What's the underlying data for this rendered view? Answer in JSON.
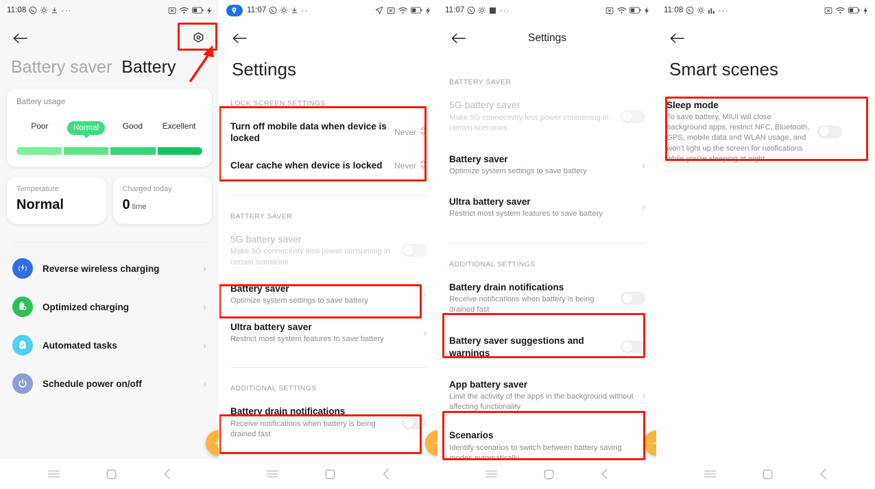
{
  "screens": [
    {
      "id": "battery-overview",
      "status": {
        "time": "11:08",
        "icons_left": [
          "whatsapp-icon",
          "gear-icon",
          "download-icon",
          "more-dots-icon"
        ],
        "icons_right": [
          "no-sim-icon",
          "wifi-icon",
          "battery-icon",
          "charging-bolt-icon"
        ]
      },
      "appbar": {
        "back": "back-arrow",
        "action": "gear-icon"
      },
      "tabs": [
        {
          "label": "Battery saver",
          "active": false
        },
        {
          "label": "Battery",
          "active": true
        }
      ],
      "usage_card": {
        "title": "Battery usage",
        "levels": [
          "Poor",
          "Normal",
          "Good",
          "Excellent"
        ],
        "current": "Normal",
        "segment_colors": [
          "#7cf09c",
          "#5fe389",
          "#35d572",
          "#16c25d"
        ]
      },
      "stats": [
        {
          "label": "Temperature",
          "value": "Normal",
          "unit": ""
        },
        {
          "label": "Charged today",
          "value": "0",
          "unit": "time"
        }
      ],
      "features": [
        {
          "label": "Reverse wireless charging",
          "icon": "reverse-wireless-charging-icon",
          "color": "#2f6fe4"
        },
        {
          "label": "Optimized charging",
          "icon": "optimized-charging-icon",
          "color": "#2fbf5a"
        },
        {
          "label": "Automated tasks",
          "icon": "automated-tasks-icon",
          "color": "#52cdf5"
        },
        {
          "label": "Schedule power on/off",
          "icon": "schedule-power-icon",
          "color": "#8a9ed4"
        }
      ]
    },
    {
      "id": "battery-saver-settings",
      "status": {
        "time": "11:07",
        "location_pill": "location-icon",
        "icons_left": [
          "whatsapp-icon",
          "gear-icon",
          "download-icon",
          "more-dots-icon"
        ],
        "icons_right": [
          "navigation-icon",
          "no-sim-icon",
          "wifi-icon",
          "battery-icon",
          "charging-bolt-icon"
        ]
      },
      "appbar": {
        "back": "back-arrow"
      },
      "title": "Settings",
      "sections": [
        {
          "header": "LOCK SCREEN SETTINGS",
          "rows": [
            {
              "title": "Turn off mobile data when device is locked",
              "subtitle": "",
              "value": "Never",
              "control": "stepper",
              "dim": false
            },
            {
              "title": "Clear cache when device is locked",
              "subtitle": "",
              "value": "Never",
              "control": "stepper",
              "dim": false
            }
          ]
        },
        {
          "header": "BATTERY SAVER",
          "rows": [
            {
              "title": "5G battery saver",
              "subtitle": "Make 5G connectivity less power consuming in certain scenarios",
              "control": "toggle",
              "toggle_on": false,
              "dim": true
            },
            {
              "title": "Battery saver",
              "subtitle": "Optimize system settings to save battery",
              "control": "chevron",
              "dim": false
            },
            {
              "title": "Ultra battery saver",
              "subtitle": "Restrict most system features to save battery",
              "control": "chevron",
              "dim": false
            }
          ]
        },
        {
          "header": "ADDITIONAL SETTINGS",
          "rows": [
            {
              "title": "Battery drain notifications",
              "subtitle": "Receive notifications when battery is being drained fast",
              "control": "toggle",
              "toggle_on": false,
              "dim": false
            }
          ]
        }
      ]
    },
    {
      "id": "settings-battery-saver",
      "status": {
        "time": "11:07",
        "icons_left": [
          "whatsapp-icon",
          "gear-icon",
          "square-icon",
          "more-dots-icon"
        ],
        "icons_right": [
          "no-sim-icon",
          "wifi-icon",
          "battery-icon",
          "charging-bolt-icon"
        ]
      },
      "appbar": {
        "back": "back-arrow",
        "title": "Settings"
      },
      "sections": [
        {
          "header": "BATTERY SAVER",
          "rows": [
            {
              "title": "5G battery saver",
              "subtitle": "Make 5G connectivity less power consuming in certain scenarios",
              "control": "toggle",
              "toggle_on": false,
              "dim": true
            },
            {
              "title": "Battery saver",
              "subtitle": "Optimize system settings to save battery",
              "control": "chevron",
              "dim": false
            },
            {
              "title": "Ultra battery saver",
              "subtitle": "Restrict most system features to save battery",
              "control": "chevron",
              "dim": false
            }
          ]
        },
        {
          "header": "ADDITIONAL SETTINGS",
          "rows": [
            {
              "title": "Battery drain notifications",
              "subtitle": "Receive notifications when battery is being drained fast",
              "control": "toggle",
              "toggle_on": false,
              "dim": false
            },
            {
              "title": "Battery saver suggestions and warnings",
              "subtitle": "",
              "control": "toggle",
              "toggle_on": false,
              "dim": false
            },
            {
              "title": "App battery saver",
              "subtitle": "Limit the activity of the apps in the background without affecting functionality",
              "control": "chevron",
              "dim": false
            },
            {
              "title": "Scenarios",
              "subtitle": "Identify scenarios to switch between battery saving modes automatically",
              "control": "chevron",
              "dim": false
            }
          ]
        }
      ]
    },
    {
      "id": "smart-scenes",
      "status": {
        "time": "11:08",
        "icons_left": [
          "whatsapp-icon",
          "gear-icon",
          "bar-chart-icon",
          "more-dots-icon"
        ],
        "icons_right": [
          "no-sim-icon",
          "wifi-icon",
          "battery-icon",
          "charging-bolt-icon"
        ]
      },
      "appbar": {
        "back": "back-arrow"
      },
      "title": "Smart scenes",
      "rows": [
        {
          "title": "Sleep mode",
          "subtitle": "To save battery, MIUI will close background apps, restrict NFC, Bluetooth, GPS, mobile data and WLAN usage, and won't light up the screen for notifications while you're sleeping at night.",
          "control": "toggle",
          "toggle_on": false
        }
      ]
    }
  ],
  "navbar": {
    "menu": "menu-icon",
    "home": "home-icon",
    "back": "back-icon"
  },
  "annotations": {
    "highlight_color": "#f41c0b",
    "arrow_color": "#f41c0b"
  },
  "fab": {
    "color": "#fcb341",
    "icon": "float-action-icon"
  }
}
